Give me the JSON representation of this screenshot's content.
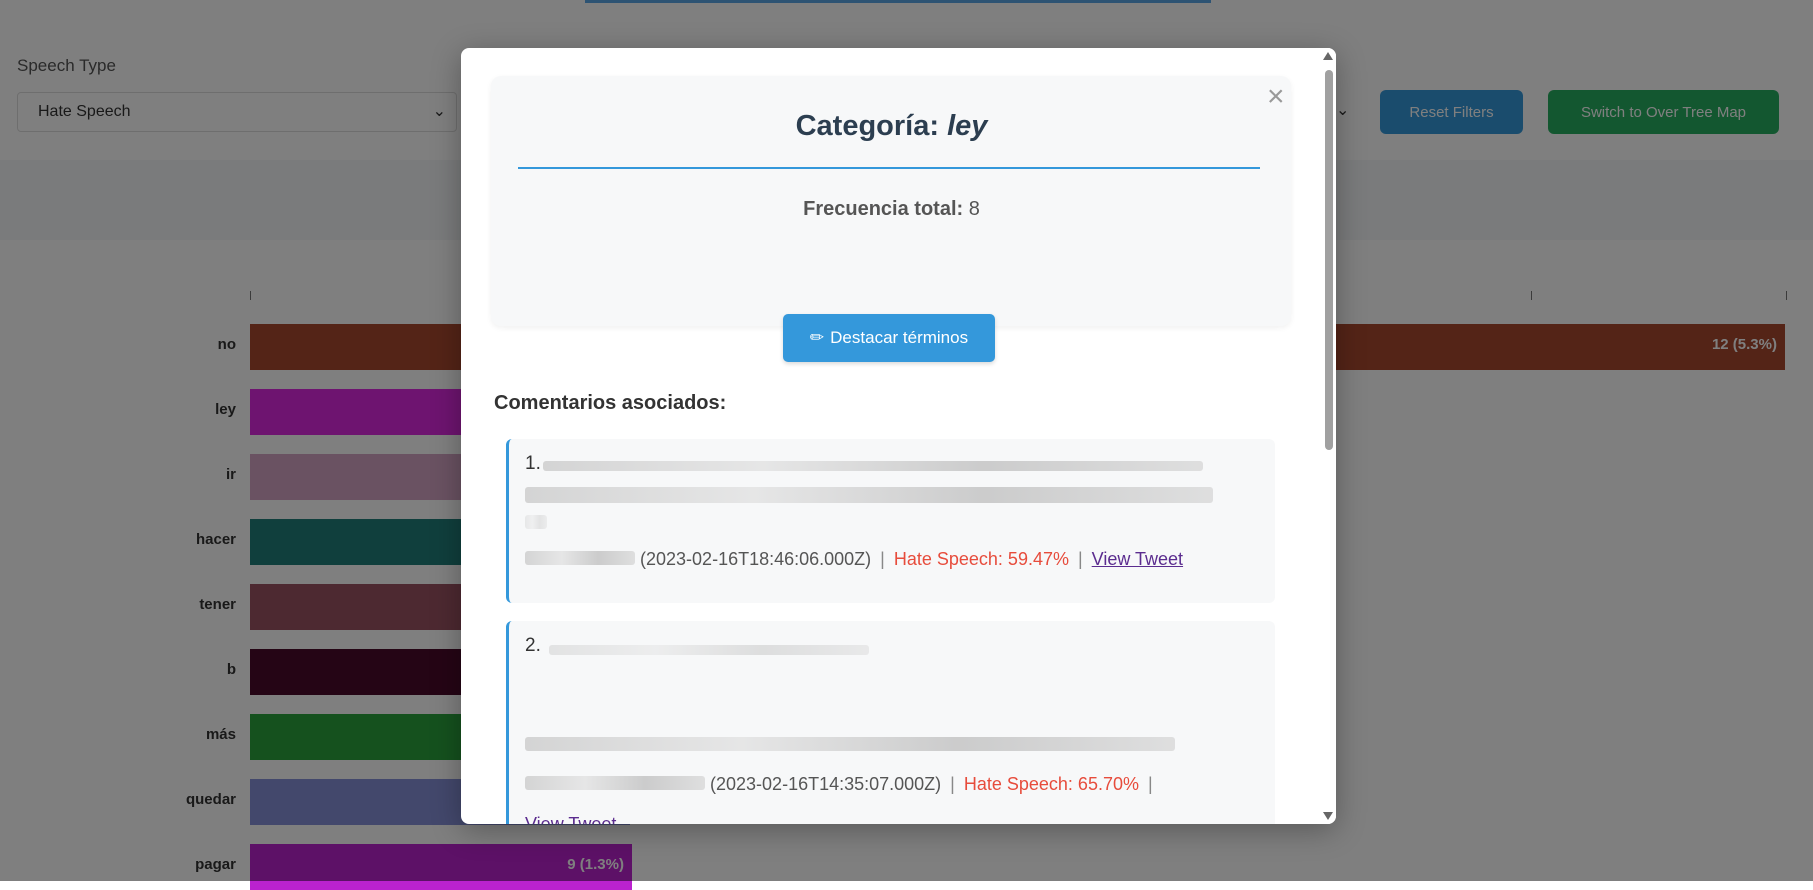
{
  "background": {
    "filter_label": "Speech Type",
    "filter_value": "Hate Speech",
    "reset_button": "Reset Filters",
    "switch_button": "Switch to Over Tree Map",
    "chart_data": {
      "type": "bar",
      "categories": [
        "no",
        "ley",
        "ir",
        "hacer",
        "tener",
        "b",
        "más",
        "quedar",
        "pagar"
      ],
      "visible_value_labels": {
        "no": "12 (5.3%)",
        "pagar": "9 (1.3%)"
      },
      "colors": [
        "#a8492f",
        "#dd28e0",
        "#d4a4c4",
        "#217e7a",
        "#9a5363",
        "#4a0a2a",
        "#2aa33c",
        "#8690d8",
        "#bb22cf"
      ]
    }
  },
  "modal": {
    "close_label": "×",
    "title_prefix": "Categoría:",
    "title_term": "ley",
    "frequency_label": "Frecuencia total:",
    "frequency_value": "8",
    "highlight_button": "Destacar términos",
    "comments_title": "Comentarios asociados:",
    "comments": [
      {
        "number": "1.",
        "date": "(2023-02-16T18:46:06.000Z)",
        "hate": "Hate Speech: 59.47%",
        "link": "View Tweet"
      },
      {
        "number": "2.",
        "date": "(2023-02-16T14:35:07.000Z)",
        "hate": "Hate Speech: 65.70%",
        "link": "View Tweet"
      }
    ]
  }
}
